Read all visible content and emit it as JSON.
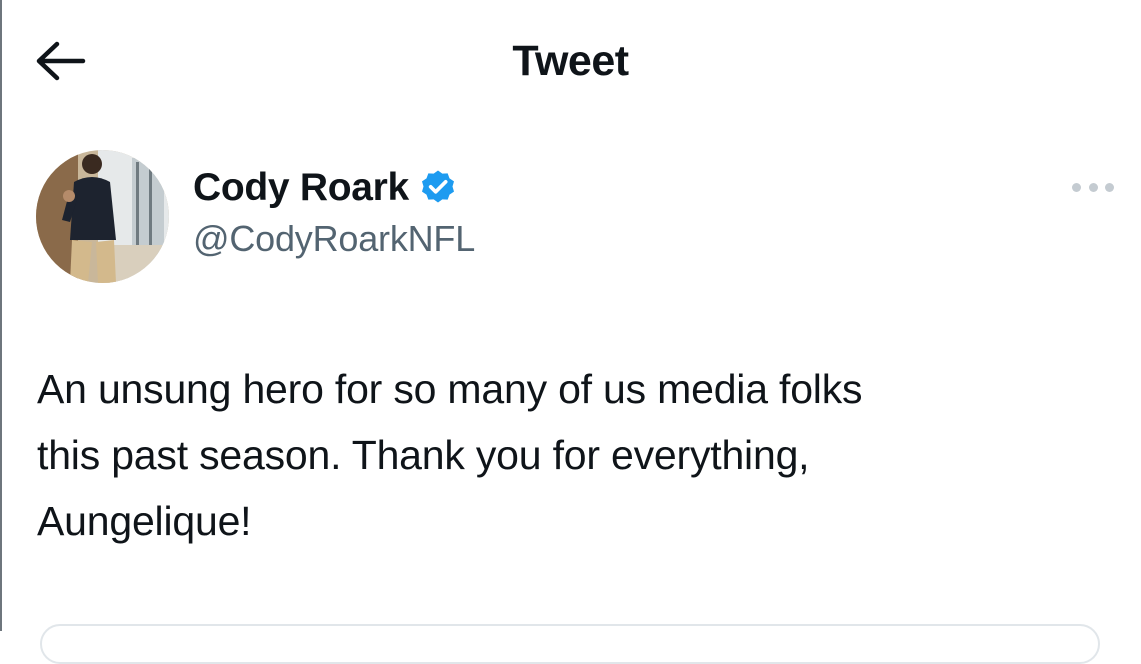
{
  "header": {
    "title": "Tweet",
    "back_icon": "arrow-left-icon"
  },
  "tweet": {
    "author": {
      "name": "Cody Roark",
      "handle": "@CodyRoarkNFL",
      "verified_icon": "verified-badge-icon",
      "verified_color": "#1d9bf0"
    },
    "text": "An unsung hero for so many of us media folks\nthis past season. Thank you for everything,\nAungelique!",
    "more_icon": "more-options-icon"
  },
  "colors": {
    "text_primary": "#0f1419",
    "text_secondary": "#536471",
    "more_dots": "#c4cbd1"
  }
}
